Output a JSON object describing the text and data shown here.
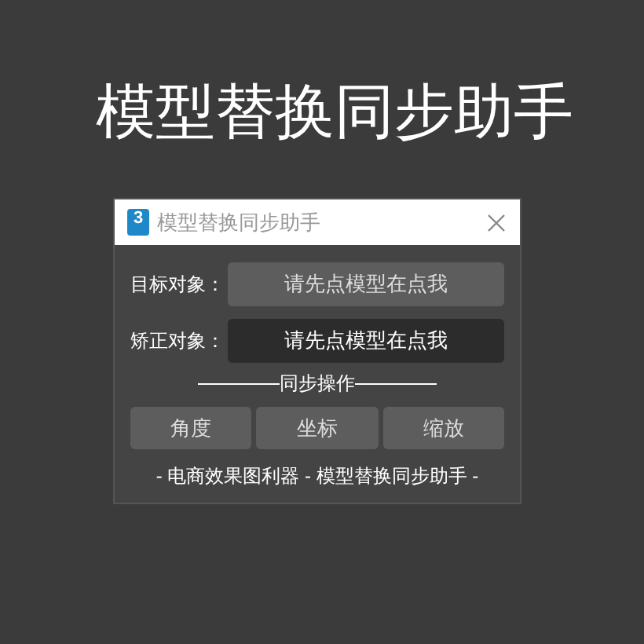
{
  "headline": "模型替换同步助手",
  "window": {
    "title": "模型替换同步助手",
    "logo": "3"
  },
  "rows": [
    {
      "label": "目标对象：",
      "value": "请先点模型在点我",
      "kind": "button"
    },
    {
      "label": "矫正对象：",
      "value": "请先点模型在点我",
      "kind": "field"
    }
  ],
  "section": "同步操作",
  "buttons": [
    "角度",
    "坐标",
    "缩放"
  ],
  "footer": "- 电商效果图利器 - 模型替换同步助手 -"
}
